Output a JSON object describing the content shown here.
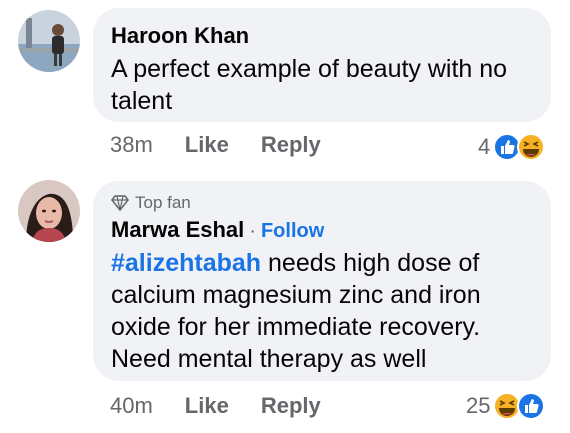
{
  "comments": [
    {
      "author": "Haroon Khan",
      "text": "A perfect example of beauty with no talent",
      "time": "38m",
      "like_label": "Like",
      "reply_label": "Reply",
      "reaction_count": "4",
      "reactions": [
        "like-icon",
        "haha-icon"
      ]
    },
    {
      "badge": "Top fan",
      "author": "Marwa Eshal",
      "follow_label": "Follow",
      "hashtag": "#alizehtabah",
      "text": " needs high dose of calcium magnesium zinc and iron oxide for her immediate recovery. Need mental therapy as well",
      "time": "40m",
      "like_label": "Like",
      "reply_label": "Reply",
      "reaction_count": "25",
      "reactions": [
        "haha-icon",
        "like-icon"
      ]
    }
  ],
  "colors": {
    "bubble": "#f0f2f5",
    "link": "#1b74e4",
    "meta": "#65676b"
  }
}
